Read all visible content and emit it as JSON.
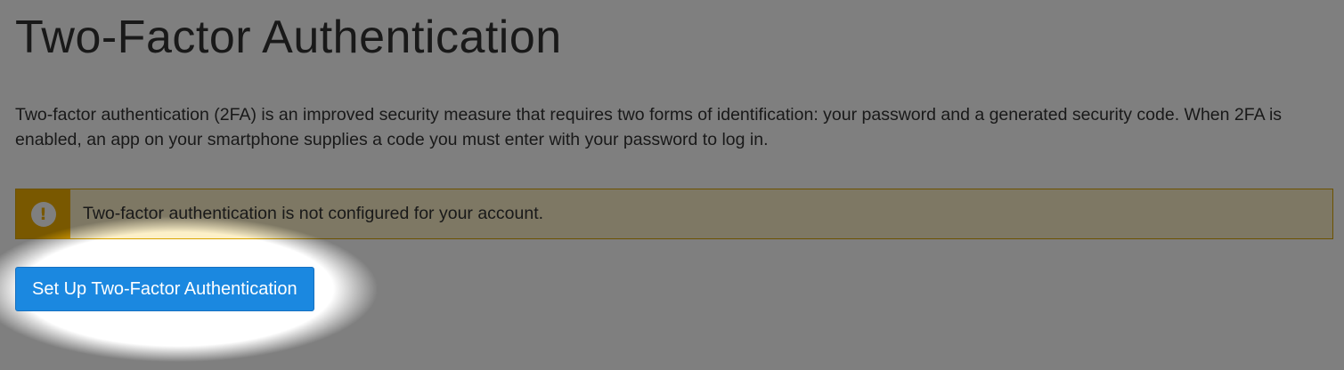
{
  "page": {
    "title": "Two-Factor Authentication",
    "description": "Two-factor authentication (2FA) is an improved security measure that requires two forms of identification: your password and a generated security code. When 2FA is enabled, an app on your smartphone supplies a code you must enter with your password to log in."
  },
  "alert": {
    "type": "warning",
    "icon": "exclamation-icon",
    "message": "Two-factor authentication is not configured for your account."
  },
  "actions": {
    "setup_label": "Set Up Two-Factor Authentication"
  },
  "colors": {
    "primary_button": "#1b88e0",
    "warning_accent": "#f2b100",
    "warning_background": "#fcf0c8",
    "text": "#333333",
    "overlay": "rgba(0,0,0,0.5)"
  }
}
